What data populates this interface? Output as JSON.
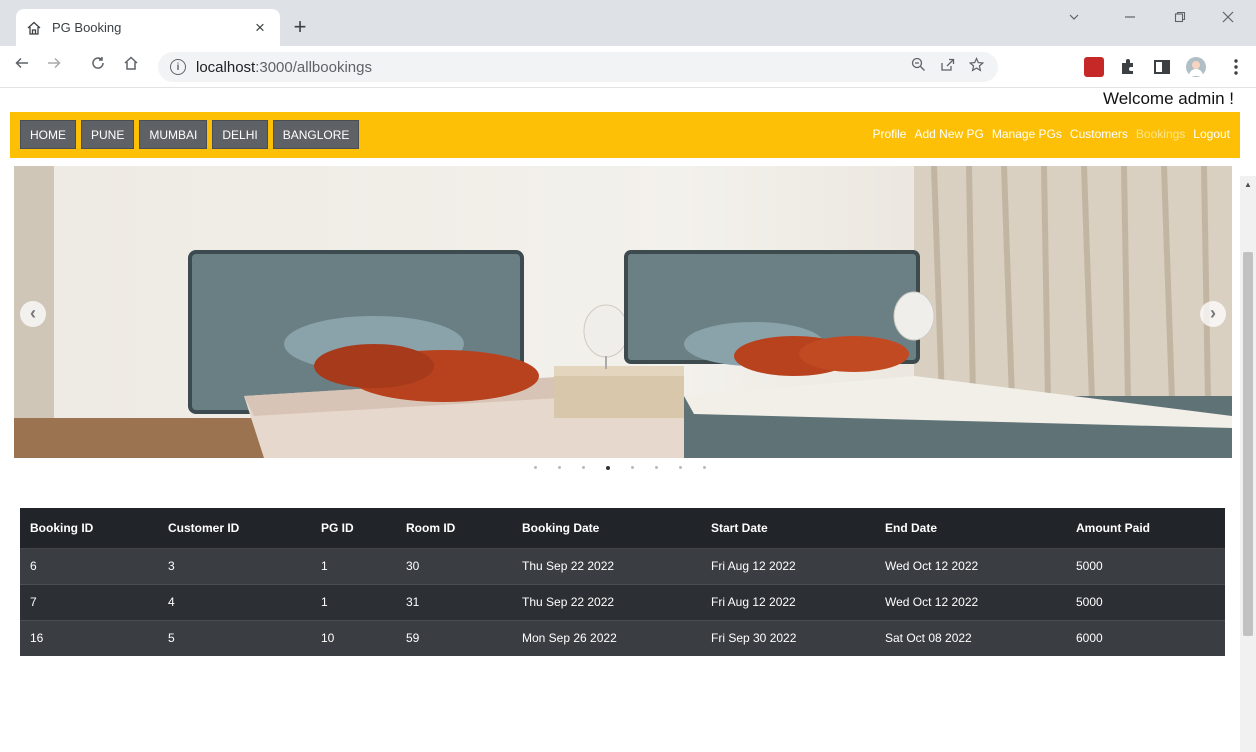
{
  "browser": {
    "tab_title": "PG Booking",
    "tab_close": "×",
    "new_tab": "+",
    "url_host": "localhost",
    "url_rest": ":3000/allbookings"
  },
  "header": {
    "welcome": "Welcome admin !"
  },
  "nav": {
    "buttons": [
      "HOME",
      "PUNE",
      "MUMBAI",
      "DELHI",
      "BANGLORE"
    ],
    "links": [
      "Profile",
      "Add New PG",
      "Manage PGs",
      "Customers",
      "Bookings",
      "Logout"
    ],
    "active_link": "Bookings"
  },
  "colors": {
    "navbar": "#fec007",
    "nav_button": "#5e6267",
    "table_header": "#212529"
  },
  "carousel": {
    "slide_count": 8,
    "active_index": 3
  },
  "table": {
    "headers": [
      "Booking ID",
      "Customer ID",
      "PG ID",
      "Room ID",
      "Booking Date",
      "Start Date",
      "End Date",
      "Amount Paid"
    ],
    "rows": [
      [
        "6",
        "3",
        "1",
        "30",
        "Thu Sep 22 2022",
        "Fri Aug 12 2022",
        "Wed Oct 12 2022",
        "5000"
      ],
      [
        "7",
        "4",
        "1",
        "31",
        "Thu Sep 22 2022",
        "Fri Aug 12 2022",
        "Wed Oct 12 2022",
        "5000"
      ],
      [
        "16",
        "5",
        "10",
        "59",
        "Mon Sep 26 2022",
        "Fri Sep 30 2022",
        "Sat Oct 08 2022",
        "6000"
      ]
    ]
  }
}
